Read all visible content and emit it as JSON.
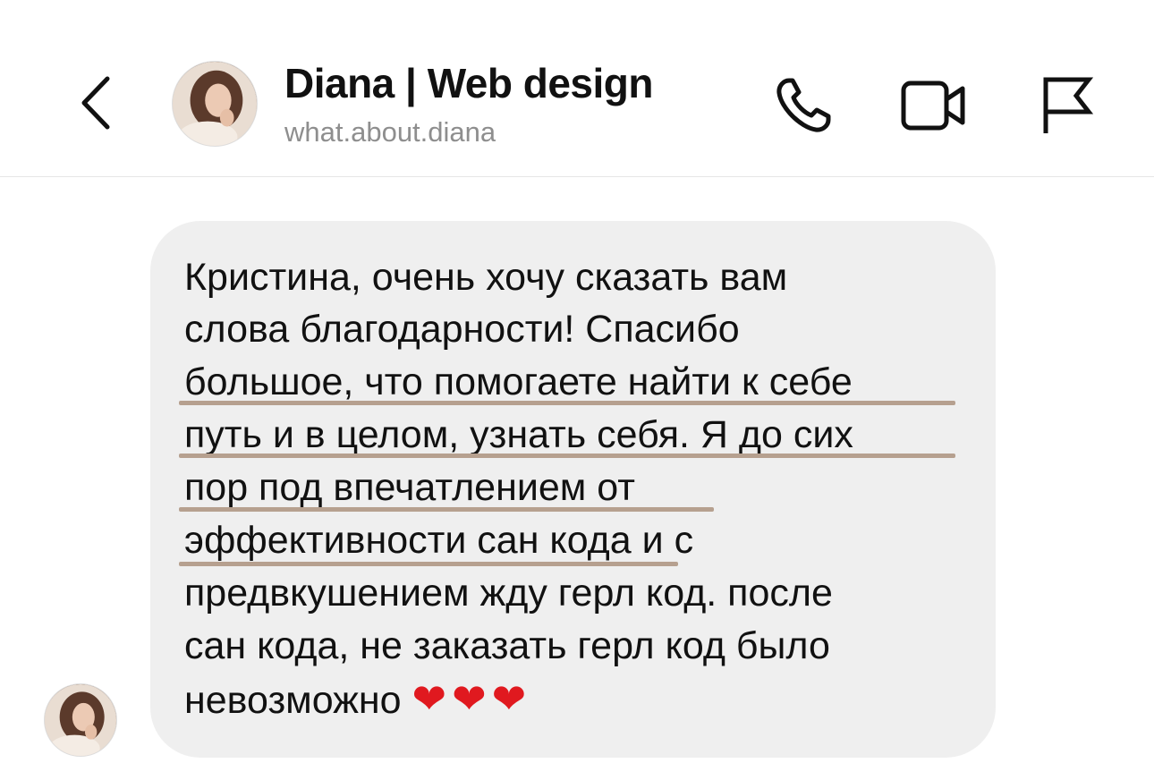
{
  "header": {
    "back_icon": "chevron-left-icon",
    "contact_name": "Diana | Web design",
    "contact_username": "what.about.diana",
    "actions": [
      {
        "icon": "phone-icon"
      },
      {
        "icon": "video-camera-icon"
      },
      {
        "icon": "flag-icon"
      }
    ]
  },
  "message": {
    "lines": [
      "Кристина, очень хочу сказать вам",
      "слова благодарности! Спасибо",
      "большое, что помогаете найти к себе",
      "путь и в целом, узнать себя. Я до сих",
      "пор под впечатлением от",
      "эффективности сан кода и с",
      "предвкушением жду герл код. после",
      "сан кода, не заказать герл код было",
      "невозможно"
    ],
    "hearts": "❤❤❤",
    "highlight_color": "#b6a08f",
    "bubble_color": "#efefef"
  }
}
